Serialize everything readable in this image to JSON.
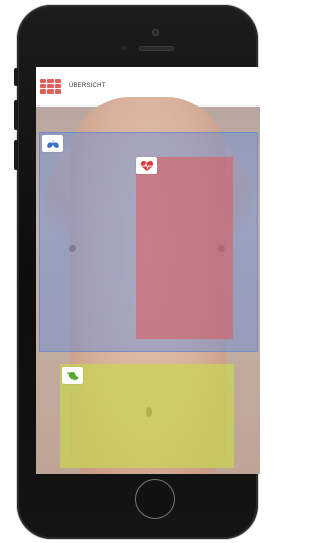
{
  "header": {
    "title": "ÜBERSICHT",
    "menu_icon": "grid-menu-icon",
    "accent_color": "#e0605a"
  },
  "zones": [
    {
      "id": "lung",
      "icon": "lung-icon",
      "color": "#648cdc"
    },
    {
      "id": "heart",
      "icon": "heart-monitor-icon",
      "color": "#dc5a5a"
    },
    {
      "id": "abdomen",
      "icon": "stomach-icon",
      "color": "#c8d750"
    }
  ]
}
